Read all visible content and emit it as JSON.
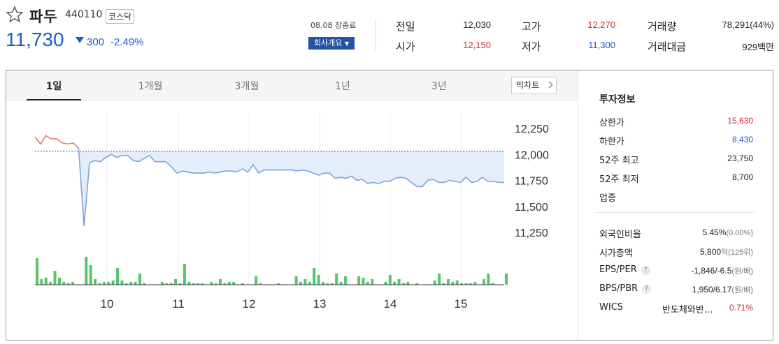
{
  "stock": {
    "name": "파두",
    "code": "440110",
    "market": "코스닥",
    "price": "11,730",
    "change": "300",
    "change_pct": "-2.49%"
  },
  "session": {
    "date_status": "08.08 장종료",
    "company_button": "회사개요"
  },
  "quote": {
    "prev_close_label": "전일",
    "prev_close": "12,030",
    "high_label": "고가",
    "high": "12,270",
    "volume_label": "거래량",
    "volume": "78,291(44%)",
    "open_label": "시가",
    "open": "12,150",
    "low_label": "저가",
    "low": "11,300",
    "turnover_label": "거래대금",
    "turnover": "929백만"
  },
  "tabs": [
    "1일",
    "1개월",
    "3개월",
    "1년",
    "3년"
  ],
  "big_chart_label": "빅차트",
  "invest": {
    "title": "투자정보",
    "upper_limit_label": "상한가",
    "upper_limit": "15,630",
    "lower_limit_label": "하한가",
    "lower_limit": "8,430",
    "high52_label": "52주 최고",
    "high52": "23,750",
    "low52_label": "52주 최저",
    "low52": "8,700",
    "sector_label": "업종",
    "foreign_label": "외국인비율",
    "foreign": "5.45%",
    "foreign_sub": "(0.00%)",
    "mcap_label": "시가총액",
    "mcap": "5,800",
    "mcap_unit": "억",
    "mcap_sub": "(125위)",
    "eps_label": "EPS/PER",
    "eps": "-1,846/-6.5",
    "eps_unit": "(원/배)",
    "bps_label": "BPS/PBR",
    "bps": "1,950/6.17",
    "bps_unit": "(원/배)",
    "wics_label": "WICS",
    "wics": "반도체와반...",
    "wics_pct": "0.71%"
  },
  "colors": {
    "up": "#d32b2b",
    "down": "#1c5bc9",
    "volume": "#56c66e",
    "accent": "#2154a8"
  },
  "chart_data": {
    "type": "line",
    "x_ticks": [
      "10",
      "11",
      "12",
      "13",
      "14",
      "15"
    ],
    "y_ticks": [
      "12,250",
      "12,000",
      "11,750",
      "11,500",
      "11,250"
    ],
    "ylim": [
      11150,
      12350
    ],
    "reference": 12030,
    "series": [
      {
        "values": [
          12170,
          12100,
          12180,
          12150,
          12150,
          12110,
          12100,
          12110,
          12060
        ]
      },
      {
        "values": [
          12060,
          11310,
          11920,
          11940,
          11930,
          11970,
          12000,
          11970,
          11990,
          11990,
          11940,
          11930,
          11960,
          11990,
          11930,
          11930,
          11930,
          11880,
          11820,
          11840,
          11830,
          11820,
          11820,
          11820,
          11830,
          11820,
          11830,
          11840,
          11840,
          11830,
          11860,
          11830,
          11900,
          11820,
          11850,
          11850,
          11850,
          11850,
          11850,
          11850,
          11840,
          11850,
          11840,
          11820,
          11800,
          11820,
          11820,
          11770,
          11780,
          11770,
          11790,
          11750,
          11760,
          11720,
          11730,
          11720,
          11740,
          11740,
          11770,
          11780,
          11770,
          11730,
          11690,
          11690,
          11750,
          11760,
          11730,
          11730,
          11750,
          11740,
          11730,
          11780,
          11730,
          11740,
          11780,
          11740,
          11740,
          11730,
          11730
        ]
      }
    ],
    "volume": [
      0.95,
      0.2,
      0.25,
      0.1,
      0.5,
      0.25,
      0.1,
      0.05,
      0.1,
      0.0,
      0.0,
      1.0,
      0.7,
      0.2,
      0.05,
      0.1,
      0.1,
      0.15,
      0.6,
      0.15,
      0.05,
      0.1,
      0.1,
      0.4,
      0.05,
      0.0,
      0.0,
      0.0,
      0.1,
      0.05,
      0.05,
      0.2,
      0.05,
      0.75,
      0.1,
      0.05,
      0.05,
      0.05,
      0.0,
      0.1,
      0.05,
      0.2,
      0.05,
      0.1,
      0.1,
      0.0,
      0.05,
      0.0,
      0.0,
      0.3,
      0.05,
      0.0,
      0.0,
      0.0,
      0.05,
      0.0,
      0.0,
      0.0,
      0.3,
      0.1,
      0.2,
      0.1,
      0.6,
      0.35,
      0.1,
      0.05,
      0.05,
      0.4,
      0.1,
      0.3,
      0.0,
      0.0,
      0.3,
      0.25,
      0.1,
      0.2,
      0.0,
      0.0,
      0.1,
      0.35,
      0.1,
      0.2,
      0.05,
      0.1,
      0.0,
      0.05,
      0.0,
      0.0,
      0.0,
      0.15,
      0.4,
      0.05,
      0.2,
      0.1,
      0.15,
      0.05,
      0.05,
      0.05,
      0.1,
      0.0,
      0.2,
      0.4,
      0.05,
      0.0,
      0.0,
      0.4
    ]
  }
}
